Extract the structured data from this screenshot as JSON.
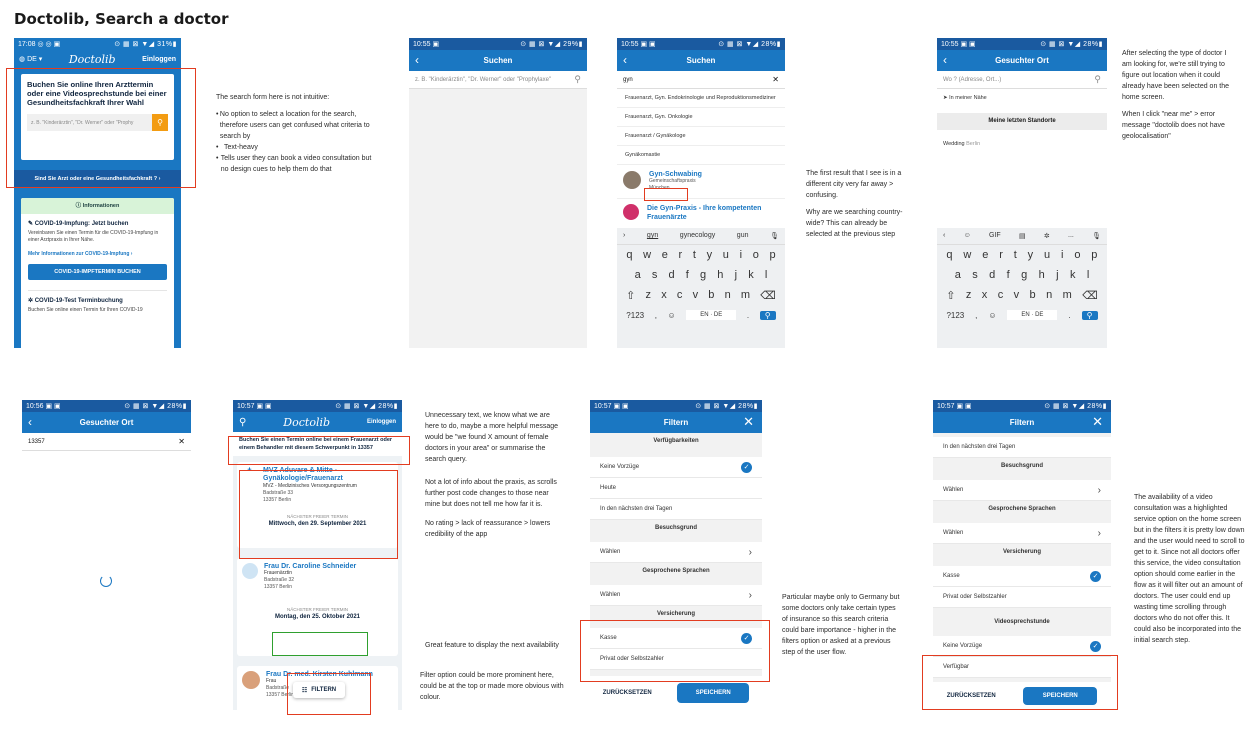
{
  "page_title": "Doctolib, Search a doctor",
  "s1": {
    "status_left": "17:08 ◎ ◎ ▣",
    "status_right": "⊙ ▦ ⊠ ▼◢ 31%▮",
    "lang": "DE",
    "logo": "Doctolib",
    "login": "Einloggen",
    "heading": "Buchen Sie online Ihren Arzttermin oder eine Videosprechstunde bei einer Gesundheitsfachkraft Ihrer Wahl",
    "search_placeholder": "z. B. \"Kinderärztin\", \"Dr. Werner\" oder \"Prophy",
    "pro_link": "Sind Sie Arzt oder eine Gesundheitsfachkraft ?",
    "info_title": "Informationen",
    "covid_title": "COVID-19-Impfung: Jetzt buchen",
    "covid_text": "Vereinbaren Sie einen Termin für die COVID-19-Impfung in einer Arztpraxis in Ihrer Nähe.",
    "covid_link": "Mehr Informationen zur COVID-19-Impfung",
    "covid_btn": "COVID-19-IMPFTERMIN BUCHEN",
    "test_title": "COVID-19-Test Terminbuchung",
    "test_text": "Buchen Sie online einen Termin für Ihren COVID-19"
  },
  "note1": {
    "intro": "The search form here is not intuitive:",
    "bullets": [
      "No option to select a location for the search, therefore users can get confused what criteria to search by",
      "Text-heavy",
      "Tells user they can book a video consultation but no design cues to help them do that"
    ]
  },
  "s2": {
    "status_left": "10:55 ▣",
    "status_right": "⊙ ▦ ⊠ ▼◢ 29%▮",
    "title": "Suchen",
    "placeholder": "z. B. \"Kinderärztin\", \"Dr. Werner\" oder \"Prophylaxe\""
  },
  "s3": {
    "status_left": "10:55 ▣ ▣",
    "status_right": "⊙ ▦ ⊠ ▼◢ 28%▮",
    "title": "Suchen",
    "query": "gyn",
    "suggestions": [
      "Frauenarzt, Gyn. Endokrinologie und Reproduktionsmediziner",
      "Frauenarzt, Gyn. Onkologie",
      "Frauenarzt / Gynäkologe",
      "Gynäkomastie"
    ],
    "r1_name": "Gyn-Schwabing",
    "r1_type": "Gemeinschaftspraxis",
    "r1_city": "München",
    "r2_name": "Die Gyn-Praxis - Ihre kompetenten Frauenärzte",
    "kb_suggest": [
      "gyn",
      "gynecology",
      "gun"
    ],
    "kb_row1": [
      "q",
      "w",
      "e",
      "r",
      "t",
      "y",
      "u",
      "i",
      "o",
      "p"
    ],
    "kb_row2": [
      "a",
      "s",
      "d",
      "f",
      "g",
      "h",
      "j",
      "k",
      "l"
    ],
    "kb_row3": [
      "z",
      "x",
      "c",
      "v",
      "b",
      "n",
      "m"
    ],
    "kb_num": "?123",
    "kb_lang": "EN · DE"
  },
  "note3": [
    "The first result that I see is in a different city very far away > confusing.",
    "Why are we searching country-wide? This can already be selected at the previous step"
  ],
  "s4": {
    "status_left": "10:55 ▣ ▣",
    "status_right": "⊙ ▦ ⊠ ▼◢ 28%▮",
    "title": "Gesuchter Ort",
    "placeholder": "Wo ? (Adresse, Ort...)",
    "near": "In meiner Nähe",
    "recent_btn": "Meine letzten Standorte",
    "recent_item": "Wedding",
    "recent_city": "Berlin",
    "kb_tools": [
      "GIF",
      "..."
    ],
    "kb_num": "?123",
    "kb_lang": "EN · DE"
  },
  "note4": [
    "After selecting the type of doctor I am looking for, we're still trying to figure out location when it could already have been selected on the home screen.",
    "When I click \"near me\" > error message \"doctolib does not have geolocalisation\""
  ],
  "s5": {
    "status_left": "10:56 ▣ ▣",
    "status_right": "⊙ ▦ ⊠ ▼◢ 28%▮",
    "title": "Gesuchter Ort",
    "query": "13357"
  },
  "s6": {
    "status_left": "10:57 ▣ ▣",
    "status_right": "⊙ ▦ ⊠ ▼◢ 28%▮",
    "logo": "Doctolib",
    "login": "Einloggen",
    "banner": "Buchen Sie einen Termin online bei einem Frauenarzt oder einem Behandler mit diesem Schwerpunkt in 13357",
    "c1_name": "MVZ Aduvare & Mitte - Gynäkologie/Frauenarzt",
    "c1_org": "MVZ - Medizinisches Versorgungszentrum",
    "c1_street": "Badstraße 33",
    "c1_city": "13357 Berlin",
    "next_label": "NÄCHSTER FREIER TERMIN",
    "c1_date": "Mittwoch, den 29. September 2021",
    "c2_name": "Frau Dr. Caroline Schneider",
    "c2_type": "Frauenärztin",
    "c2_street": "Badstraße 32",
    "c2_city": "13357 Berlin",
    "c2_date": "Montag, den 25. Oktober 2021",
    "c3_name": "Frau Dr. med. Kirsten Kuhlmann",
    "c3_type": "Frau",
    "c3_street": "Badstraße",
    "c3_city": "13357 Berlin",
    "filter_btn": "FILTERN"
  },
  "note6": {
    "text1": "Unnecessary text, we know what we are here to do, maybe a more helpful message would be \"we found X amount of female doctors in your area\" or summarise the search query.",
    "text2": "Not a lot of info about the praxis, as scrolls further post code changes to those near mine but does not tell me how far it is.",
    "text3": "No rating > lack of reassurance > lowers credibility of the app",
    "text4": "Great feature to display the next availability",
    "text5": "Filter option could be more prominent here, could be at the top or made more obvious with colour."
  },
  "s7": {
    "status_left": "10:57 ▣ ▣",
    "status_right": "⊙ ▦ ⊠ ▼◢ 28%▮",
    "title": "Filtern",
    "h_avail": "Verfügbarkeiten",
    "o_none": "Keine Vorzüge",
    "o_today": "Heute",
    "o_three": "In den nächsten drei Tagen",
    "h_reason": "Besuchsgrund",
    "choose": "Wählen",
    "h_lang": "Gesprochene Sprachen",
    "h_ins": "Versicherung",
    "o_kasse": "Kasse",
    "o_privat": "Privat oder Selbstzahler",
    "reset": "ZURÜCKSETZEN",
    "save": "SPEICHERN"
  },
  "note7": "Particular maybe only to Germany but some doctors only take certain types of insurance so this search criteria could bare importance - higher in the filters option or asked at a previous step of the user flow.",
  "s8": {
    "status_left": "10:57 ▣ ▣",
    "status_right": "⊙ ▦ ⊠ ▼◢ 28%▮",
    "title": "Filtern",
    "o_three": "In den nächsten drei Tagen",
    "h_reason": "Besuchsgrund",
    "choose": "Wählen",
    "h_lang": "Gesprochene Sprachen",
    "h_ins": "Versicherung",
    "o_kasse": "Kasse",
    "o_privat": "Privat oder Selbstzahler",
    "h_video": "Videosprechstunde",
    "o_none": "Keine Vorzüge",
    "o_avail": "Verfügbar",
    "reset": "ZURÜCKSETZEN",
    "save": "SPEICHERN"
  },
  "note8": "The availability of a video consultation was a highlighted service option on the home screen but in the filters it is pretty low down and the user would need to scroll to get to it. Since not all doctors offer this service, the video consultation option should come earlier in the flow as it will filter out an amount of doctors. The user could end up wasting time scrolling through doctors who do not offer this. It could also be incorporated into the initial search step.",
  "colors": {
    "brand_blue": "#1a77c2",
    "annotation_red": "#e23c20",
    "annotation_green": "#2fa02f",
    "orange": "#f39c12"
  }
}
